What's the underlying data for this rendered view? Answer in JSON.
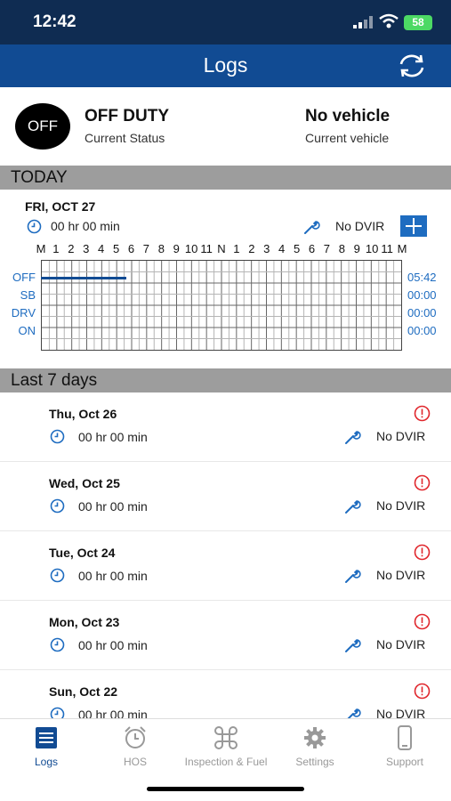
{
  "status_bar": {
    "time": "12:42",
    "battery": "58"
  },
  "nav": {
    "title": "Logs",
    "sync_icon": "sync-icon"
  },
  "status": {
    "badge": "OFF",
    "status_label": "OFF DUTY",
    "status_caption": "Current Status",
    "vehicle_label": "No vehicle",
    "vehicle_caption": "Current vehicle"
  },
  "today": {
    "section_title": "TODAY",
    "date": "FRI, OCT 27",
    "hours": "00 hr 00 min",
    "dvir": "No DVIR",
    "hour_labels": [
      "M",
      "1",
      "2",
      "3",
      "4",
      "5",
      "6",
      "7",
      "8",
      "9",
      "10",
      "11",
      "N",
      "1",
      "2",
      "3",
      "4",
      "5",
      "6",
      "7",
      "8",
      "9",
      "10",
      "11",
      "M"
    ],
    "rows": [
      {
        "label": "OFF",
        "total": "05:42"
      },
      {
        "label": "SB",
        "total": "00:00"
      },
      {
        "label": "DRV",
        "total": "00:00"
      },
      {
        "label": "ON",
        "total": "00:00"
      }
    ],
    "off_duty_hours": 5.7
  },
  "last7": {
    "section_title": "Last 7 days",
    "days": [
      {
        "date": "Thu, Oct 26",
        "hours": "00 hr 00 min",
        "dvir": "No DVIR"
      },
      {
        "date": "Wed, Oct 25",
        "hours": "00 hr 00 min",
        "dvir": "No DVIR"
      },
      {
        "date": "Tue, Oct 24",
        "hours": "00 hr 00 min",
        "dvir": "No DVIR"
      },
      {
        "date": "Mon, Oct 23",
        "hours": "00 hr 00 min",
        "dvir": "No DVIR"
      },
      {
        "date": "Sun, Oct 22",
        "hours": "00 hr 00 min",
        "dvir": "No DVIR"
      }
    ]
  },
  "tabs": [
    {
      "label": "Logs",
      "icon": "logs-icon",
      "active": true
    },
    {
      "label": "HOS",
      "icon": "alarm-clock-icon",
      "active": false
    },
    {
      "label": "Inspection & Fuel",
      "icon": "command-icon",
      "active": false
    },
    {
      "label": "Settings",
      "icon": "gear-icon",
      "active": false
    },
    {
      "label": "Support",
      "icon": "phone-icon",
      "active": false
    }
  ],
  "colors": {
    "nav_blue": "#114b93",
    "status_navy": "#0f2c52",
    "accent": "#1e6cc0",
    "alert_red": "#e0262c"
  }
}
